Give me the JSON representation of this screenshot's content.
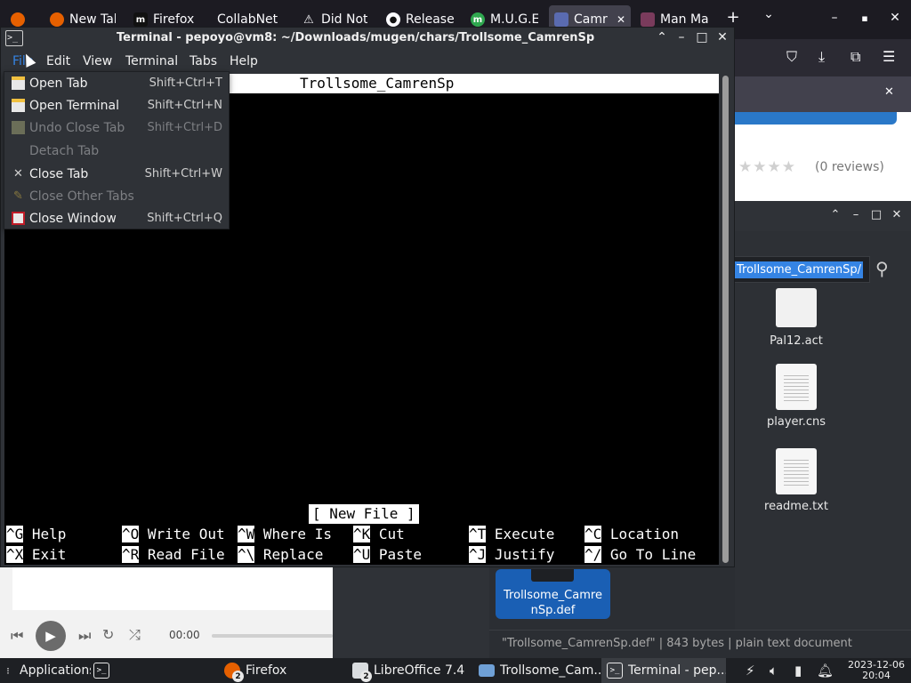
{
  "firefox": {
    "tabs": [
      {
        "label": "",
        "icon": "firefox-icon"
      },
      {
        "label": "New Tal",
        "icon": "firefox-icon"
      },
      {
        "label": "Firefox",
        "icon": "m-icon"
      },
      {
        "label": "CollabNet",
        "icon": ""
      },
      {
        "label": "Did Not",
        "icon": "warning-icon"
      },
      {
        "label": "Release",
        "icon": "github-icon"
      },
      {
        "label": "M.U.G.E",
        "icon": "m-icon"
      },
      {
        "label": "Camr",
        "icon": "image-icon"
      },
      {
        "label": "Man Ma",
        "icon": "image-icon"
      }
    ],
    "new_tab_glyph": "+",
    "tab_list_glyph": "⌄",
    "win_controls": {
      "minimize": "–",
      "maximize": "▪",
      "close": "✕"
    },
    "toolbar_icons": {
      "pocket": "⛉",
      "downloads": "⤓",
      "extensions": "⧉",
      "menu": "☰"
    },
    "notification_close": "✕",
    "page": {
      "stars": "★★★★",
      "reviews": "(0 reviews)"
    }
  },
  "terminal": {
    "icon_text": ">_",
    "title": "Terminal - pepoyo@vm8: ~/Downloads/mugen/chars/Trollsome_CamrenSp",
    "controls": {
      "up": "⌃",
      "minimize": "–",
      "maximize": "□",
      "close": "✕"
    },
    "menu": [
      "File",
      "Edit",
      "View",
      "Terminal",
      "Tabs",
      "Help"
    ],
    "nano": {
      "header": "Trollsome_CamrenSp",
      "status": "[ New File ]",
      "shortcuts": [
        [
          {
            "key": "^G",
            "label": " Help"
          },
          {
            "key": "^O",
            "label": " Write Out"
          },
          {
            "key": "^W",
            "label": " Where Is"
          },
          {
            "key": "^K",
            "label": " Cut"
          },
          {
            "key": "^T",
            "label": " Execute"
          },
          {
            "key": "^C",
            "label": " Location"
          }
        ],
        [
          {
            "key": "^X",
            "label": " Exit"
          },
          {
            "key": "^R",
            "label": " Read File"
          },
          {
            "key": "^\\",
            "label": " Replace"
          },
          {
            "key": "^U",
            "label": " Paste"
          },
          {
            "key": "^J",
            "label": " Justify"
          },
          {
            "key": "^/",
            "label": " Go To Line"
          }
        ]
      ]
    }
  },
  "file_menu": {
    "items": [
      {
        "label": "Open Tab",
        "accel": "Shift+Ctrl+T",
        "enabled": true,
        "icon": "new-tab-icon"
      },
      {
        "label": "Open Terminal",
        "accel": "Shift+Ctrl+N",
        "enabled": true,
        "icon": "new-window-icon"
      },
      {
        "label": "Undo Close Tab",
        "accel": "Shift+Ctrl+D",
        "enabled": false,
        "icon": "undo-tab-icon"
      },
      {
        "label": "Detach Tab",
        "accel": "",
        "enabled": false,
        "icon": ""
      },
      {
        "label": "Close Tab",
        "accel": "Shift+Ctrl+W",
        "enabled": true,
        "icon": "close-icon"
      },
      {
        "label": "Close Other Tabs",
        "accel": "",
        "enabled": false,
        "icon": "broom-icon"
      },
      {
        "label": "Close Window",
        "accel": "Shift+Ctrl+Q",
        "enabled": true,
        "icon": "close-window-icon"
      }
    ]
  },
  "file_manager": {
    "controls": {
      "up": "⌃",
      "minimize": "–",
      "maximize": "□",
      "close": "✕"
    },
    "location": "Trollsome_CamrenSp/",
    "search_glyph": "⚲",
    "files": [
      {
        "name": "Pal12.act",
        "type": "blank"
      },
      {
        "name": "player.cns",
        "type": "text"
      },
      {
        "name": "readme.txt",
        "type": "text"
      }
    ],
    "selected_file": "Trollsome_CamrenSp.def",
    "status": "\"Trollsome_CamrenSp.def\"  |  843 bytes  |  plain text document"
  },
  "media": {
    "time": "00:00"
  },
  "taskbar": {
    "apps_label": "Applications",
    "items": [
      {
        "label": "Firefox",
        "badge": "2"
      },
      {
        "label": "LibreOffice 7.4",
        "badge": "2"
      },
      {
        "label": "Trollsome_Cam...",
        "badge": ""
      },
      {
        "label": "Terminal - pep...",
        "badge": ""
      }
    ],
    "date": "2023-12-06",
    "time": "20:04"
  },
  "colors": {
    "accent": "#3584e4",
    "selected": "#1a5fb4",
    "terminal_bg": "#000000"
  }
}
